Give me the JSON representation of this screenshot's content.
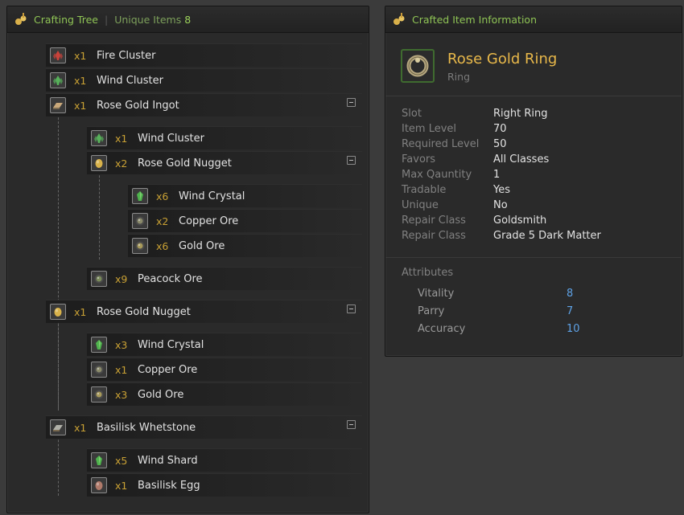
{
  "tree": {
    "title": "Crafting Tree",
    "subtitle": "Unique Items",
    "unique_count": "8",
    "rows": [
      {
        "qty": "x1",
        "name": "Fire Cluster",
        "icon": "fire-cluster-icon",
        "color": "#c9423a"
      },
      {
        "qty": "x1",
        "name": "Wind Cluster",
        "icon": "wind-cluster-icon",
        "color": "#57b05a"
      },
      {
        "qty": "x1",
        "name": "Rose Gold Ingot",
        "icon": "ingot-icon",
        "color": "#c9a87a"
      },
      {
        "qty": "x1",
        "name": "Wind Cluster",
        "icon": "wind-cluster-icon",
        "color": "#57b05a"
      },
      {
        "qty": "x2",
        "name": "Rose Gold Nugget",
        "icon": "nugget-icon",
        "color": "#d8b24a"
      },
      {
        "qty": "x6",
        "name": "Wind Crystal",
        "icon": "wind-crystal-icon",
        "color": "#4fb34d"
      },
      {
        "qty": "x2",
        "name": "Copper Ore",
        "icon": "ore-icon",
        "color": "#8a8a6a"
      },
      {
        "qty": "x6",
        "name": "Gold Ore",
        "icon": "ore-icon",
        "color": "#a89a5a"
      },
      {
        "qty": "x9",
        "name": "Peacock Ore",
        "icon": "ore-icon",
        "color": "#7a8a5a"
      },
      {
        "qty": "x1",
        "name": "Rose Gold Nugget",
        "icon": "nugget-icon",
        "color": "#d8b24a"
      },
      {
        "qty": "x3",
        "name": "Wind Crystal",
        "icon": "wind-crystal-icon",
        "color": "#4fb34d"
      },
      {
        "qty": "x1",
        "name": "Copper Ore",
        "icon": "ore-icon",
        "color": "#8a8a6a"
      },
      {
        "qty": "x3",
        "name": "Gold Ore",
        "icon": "ore-icon",
        "color": "#a89a5a"
      },
      {
        "qty": "x1",
        "name": "Basilisk Whetstone",
        "icon": "whetstone-icon",
        "color": "#b0b0a8"
      },
      {
        "qty": "x5",
        "name": "Wind Shard",
        "icon": "wind-shard-icon",
        "color": "#4fb34d"
      },
      {
        "qty": "x1",
        "name": "Basilisk Egg",
        "icon": "egg-icon",
        "color": "#b07a6a"
      }
    ]
  },
  "info": {
    "title": "Crafted Item Information",
    "item_name": "Rose Gold Ring",
    "item_type": "Ring",
    "props": [
      {
        "k": "Slot",
        "v": "Right Ring"
      },
      {
        "k": "Item Level",
        "v": "70"
      },
      {
        "k": "Required Level",
        "v": "50"
      },
      {
        "k": "Favors",
        "v": "All Classes"
      },
      {
        "k": "Max Qauntity",
        "v": "1"
      },
      {
        "k": "Tradable",
        "v": "Yes"
      },
      {
        "k": "Unique",
        "v": "No"
      },
      {
        "k": "Repair Class",
        "v": "Goldsmith"
      },
      {
        "k": "Repair Class",
        "v": "Grade 5 Dark Matter"
      }
    ],
    "attr_title": "Attributes",
    "attrs": [
      {
        "k": "Vitality",
        "v": "8"
      },
      {
        "k": "Parry",
        "v": "7"
      },
      {
        "k": "Accuracy",
        "v": "10"
      }
    ]
  }
}
